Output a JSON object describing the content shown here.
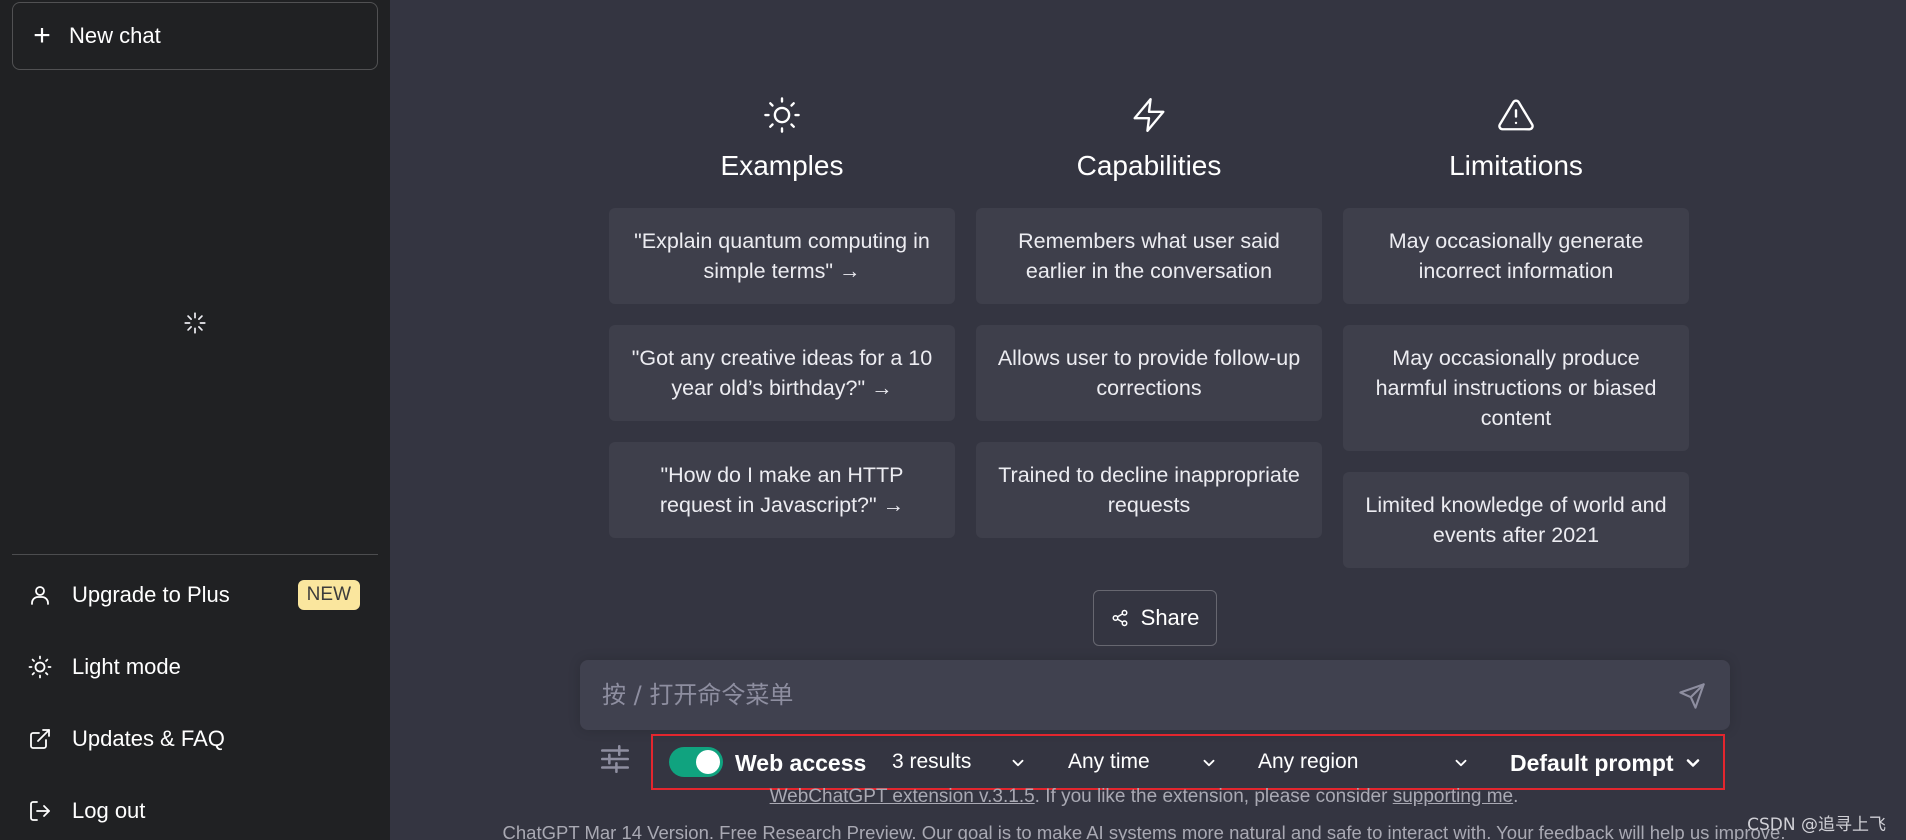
{
  "sidebar": {
    "new_chat": "New chat",
    "items": [
      {
        "label": "Upgrade to Plus",
        "badge": "NEW",
        "icon": "user-icon"
      },
      {
        "label": "Light mode",
        "icon": "sun-icon"
      },
      {
        "label": "Updates & FAQ",
        "icon": "external-link-icon"
      },
      {
        "label": "Log out",
        "icon": "logout-icon"
      }
    ]
  },
  "columns": [
    {
      "title": "Examples",
      "icon": "sun-icon",
      "cards": [
        "\"Explain quantum computing in simple terms\" →",
        "\"Got any creative ideas for a 10 year old’s birthday?\" →",
        "\"How do I make an HTTP request in Javascript?\" →"
      ]
    },
    {
      "title": "Capabilities",
      "icon": "lightning-icon",
      "cards": [
        "Remembers what user said earlier in the conversation",
        "Allows user to provide follow-up corrections",
        "Trained to decline inappropriate requests"
      ]
    },
    {
      "title": "Limitations",
      "icon": "warning-icon",
      "cards": [
        "May occasionally generate incorrect information",
        "May occasionally produce harmful instructions or biased content",
        "Limited knowledge of world and events after 2021"
      ]
    }
  ],
  "share_label": "Share",
  "composer": {
    "placeholder": "按 / 打开命令菜单"
  },
  "toolbar": {
    "web_access": "Web access",
    "web_access_on": true,
    "results": "3 results",
    "time": "Any time",
    "region": "Any region",
    "prompt": "Default prompt"
  },
  "footer": {
    "ext_link": "WebChatGPT extension v.3.1.5",
    "ext_text": ". If you like the extension, please consider ",
    "support_link": "supporting me",
    "ext_end": ".",
    "version_line": "ChatGPT Mar 14 Version. Free Research Preview. Our goal is to make AI systems more natural and safe to interact with. Your feedback will help us improve."
  },
  "watermark": "CSDN @追寻上飞",
  "colors": {
    "accent": "#10a37f",
    "sidebar": "#202123",
    "main": "#343541",
    "highlight_border": "#e3262e",
    "badge": "#fae69e"
  }
}
